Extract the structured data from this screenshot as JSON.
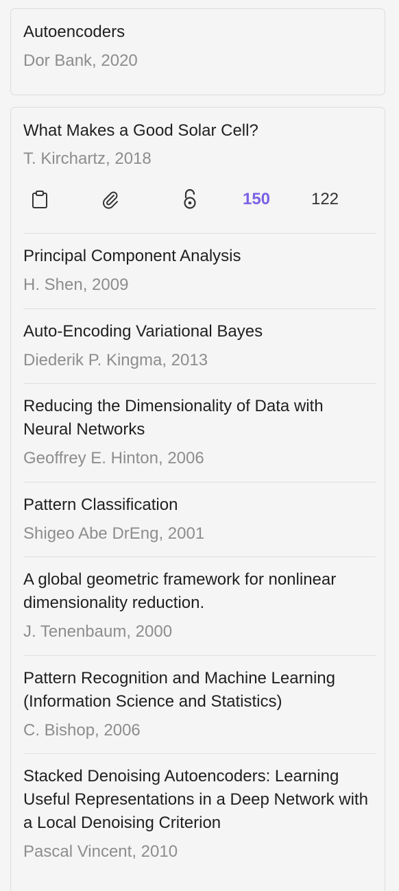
{
  "cards": {
    "top": {
      "title": "Autoencoders",
      "author": "Dor Bank, 2020"
    },
    "featured": {
      "title": "What Makes a Good Solar Cell?",
      "author": "T. Kirchartz, 2018",
      "actions": {
        "icons": [
          "clipboard-icon",
          "paperclip-icon",
          "open-access-icon"
        ],
        "citations_count": "150",
        "references_count": "122"
      }
    }
  },
  "related": [
    {
      "title": "Principal Component Analysis",
      "author": "H. Shen, 2009"
    },
    {
      "title": "Auto-Encoding Variational Bayes",
      "author": "Diederik P. Kingma, 2013"
    },
    {
      "title": "Reducing the Dimensionality of Data with Neural Networks",
      "author": "Geoffrey E. Hinton, 2006"
    },
    {
      "title": "Pattern Classification",
      "author": "Shigeo Abe DrEng, 2001"
    },
    {
      "title": "A global geometric framework for nonlinear dimensionality reduction.",
      "author": "J. Tenenbaum, 2000"
    },
    {
      "title": "Pattern Recognition and Machine Learning (Information Science and Statistics)",
      "author": "C. Bishop, 2006"
    },
    {
      "title": "Stacked Denoising Autoencoders: Learning Useful Representations in a Deep Network with a Local Denoising Criterion",
      "author": "Pascal Vincent, 2010"
    }
  ],
  "colors": {
    "accent": "#7b61e4",
    "title": "#1f1f1f",
    "muted": "#8d8d8d",
    "background": "#f5f5f5",
    "border": "#dcdcdc"
  }
}
